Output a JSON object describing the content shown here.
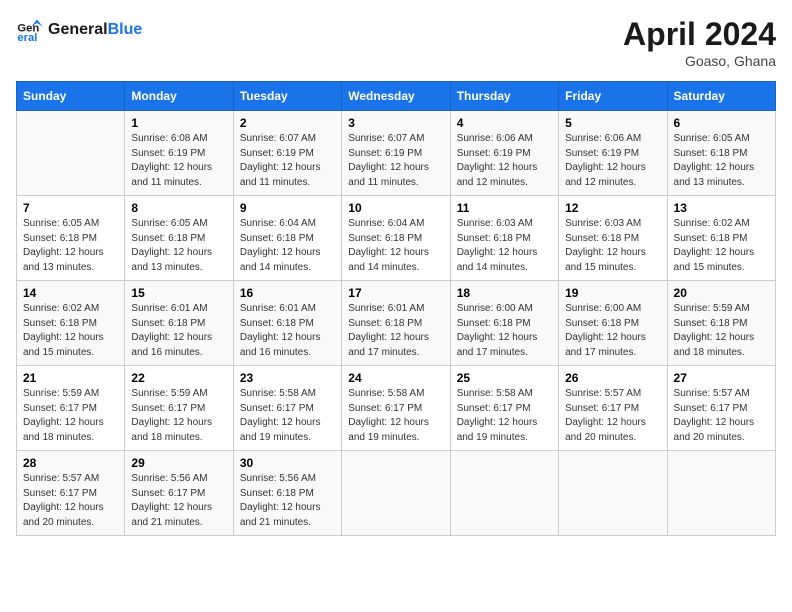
{
  "header": {
    "logo_line1": "General",
    "logo_line2": "Blue",
    "month": "April 2024",
    "location": "Goaso, Ghana"
  },
  "weekdays": [
    "Sunday",
    "Monday",
    "Tuesday",
    "Wednesday",
    "Thursday",
    "Friday",
    "Saturday"
  ],
  "weeks": [
    [
      {
        "day": "",
        "sunrise": "",
        "sunset": "",
        "daylight": ""
      },
      {
        "day": "1",
        "sunrise": "Sunrise: 6:08 AM",
        "sunset": "Sunset: 6:19 PM",
        "daylight": "Daylight: 12 hours and 11 minutes."
      },
      {
        "day": "2",
        "sunrise": "Sunrise: 6:07 AM",
        "sunset": "Sunset: 6:19 PM",
        "daylight": "Daylight: 12 hours and 11 minutes."
      },
      {
        "day": "3",
        "sunrise": "Sunrise: 6:07 AM",
        "sunset": "Sunset: 6:19 PM",
        "daylight": "Daylight: 12 hours and 11 minutes."
      },
      {
        "day": "4",
        "sunrise": "Sunrise: 6:06 AM",
        "sunset": "Sunset: 6:19 PM",
        "daylight": "Daylight: 12 hours and 12 minutes."
      },
      {
        "day": "5",
        "sunrise": "Sunrise: 6:06 AM",
        "sunset": "Sunset: 6:19 PM",
        "daylight": "Daylight: 12 hours and 12 minutes."
      },
      {
        "day": "6",
        "sunrise": "Sunrise: 6:05 AM",
        "sunset": "Sunset: 6:18 PM",
        "daylight": "Daylight: 12 hours and 13 minutes."
      }
    ],
    [
      {
        "day": "7",
        "sunrise": "Sunrise: 6:05 AM",
        "sunset": "Sunset: 6:18 PM",
        "daylight": "Daylight: 12 hours and 13 minutes."
      },
      {
        "day": "8",
        "sunrise": "Sunrise: 6:05 AM",
        "sunset": "Sunset: 6:18 PM",
        "daylight": "Daylight: 12 hours and 13 minutes."
      },
      {
        "day": "9",
        "sunrise": "Sunrise: 6:04 AM",
        "sunset": "Sunset: 6:18 PM",
        "daylight": "Daylight: 12 hours and 14 minutes."
      },
      {
        "day": "10",
        "sunrise": "Sunrise: 6:04 AM",
        "sunset": "Sunset: 6:18 PM",
        "daylight": "Daylight: 12 hours and 14 minutes."
      },
      {
        "day": "11",
        "sunrise": "Sunrise: 6:03 AM",
        "sunset": "Sunset: 6:18 PM",
        "daylight": "Daylight: 12 hours and 14 minutes."
      },
      {
        "day": "12",
        "sunrise": "Sunrise: 6:03 AM",
        "sunset": "Sunset: 6:18 PM",
        "daylight": "Daylight: 12 hours and 15 minutes."
      },
      {
        "day": "13",
        "sunrise": "Sunrise: 6:02 AM",
        "sunset": "Sunset: 6:18 PM",
        "daylight": "Daylight: 12 hours and 15 minutes."
      }
    ],
    [
      {
        "day": "14",
        "sunrise": "Sunrise: 6:02 AM",
        "sunset": "Sunset: 6:18 PM",
        "daylight": "Daylight: 12 hours and 15 minutes."
      },
      {
        "day": "15",
        "sunrise": "Sunrise: 6:01 AM",
        "sunset": "Sunset: 6:18 PM",
        "daylight": "Daylight: 12 hours and 16 minutes."
      },
      {
        "day": "16",
        "sunrise": "Sunrise: 6:01 AM",
        "sunset": "Sunset: 6:18 PM",
        "daylight": "Daylight: 12 hours and 16 minutes."
      },
      {
        "day": "17",
        "sunrise": "Sunrise: 6:01 AM",
        "sunset": "Sunset: 6:18 PM",
        "daylight": "Daylight: 12 hours and 17 minutes."
      },
      {
        "day": "18",
        "sunrise": "Sunrise: 6:00 AM",
        "sunset": "Sunset: 6:18 PM",
        "daylight": "Daylight: 12 hours and 17 minutes."
      },
      {
        "day": "19",
        "sunrise": "Sunrise: 6:00 AM",
        "sunset": "Sunset: 6:18 PM",
        "daylight": "Daylight: 12 hours and 17 minutes."
      },
      {
        "day": "20",
        "sunrise": "Sunrise: 5:59 AM",
        "sunset": "Sunset: 6:18 PM",
        "daylight": "Daylight: 12 hours and 18 minutes."
      }
    ],
    [
      {
        "day": "21",
        "sunrise": "Sunrise: 5:59 AM",
        "sunset": "Sunset: 6:17 PM",
        "daylight": "Daylight: 12 hours and 18 minutes."
      },
      {
        "day": "22",
        "sunrise": "Sunrise: 5:59 AM",
        "sunset": "Sunset: 6:17 PM",
        "daylight": "Daylight: 12 hours and 18 minutes."
      },
      {
        "day": "23",
        "sunrise": "Sunrise: 5:58 AM",
        "sunset": "Sunset: 6:17 PM",
        "daylight": "Daylight: 12 hours and 19 minutes."
      },
      {
        "day": "24",
        "sunrise": "Sunrise: 5:58 AM",
        "sunset": "Sunset: 6:17 PM",
        "daylight": "Daylight: 12 hours and 19 minutes."
      },
      {
        "day": "25",
        "sunrise": "Sunrise: 5:58 AM",
        "sunset": "Sunset: 6:17 PM",
        "daylight": "Daylight: 12 hours and 19 minutes."
      },
      {
        "day": "26",
        "sunrise": "Sunrise: 5:57 AM",
        "sunset": "Sunset: 6:17 PM",
        "daylight": "Daylight: 12 hours and 20 minutes."
      },
      {
        "day": "27",
        "sunrise": "Sunrise: 5:57 AM",
        "sunset": "Sunset: 6:17 PM",
        "daylight": "Daylight: 12 hours and 20 minutes."
      }
    ],
    [
      {
        "day": "28",
        "sunrise": "Sunrise: 5:57 AM",
        "sunset": "Sunset: 6:17 PM",
        "daylight": "Daylight: 12 hours and 20 minutes."
      },
      {
        "day": "29",
        "sunrise": "Sunrise: 5:56 AM",
        "sunset": "Sunset: 6:17 PM",
        "daylight": "Daylight: 12 hours and 21 minutes."
      },
      {
        "day": "30",
        "sunrise": "Sunrise: 5:56 AM",
        "sunset": "Sunset: 6:18 PM",
        "daylight": "Daylight: 12 hours and 21 minutes."
      },
      {
        "day": "",
        "sunrise": "",
        "sunset": "",
        "daylight": ""
      },
      {
        "day": "",
        "sunrise": "",
        "sunset": "",
        "daylight": ""
      },
      {
        "day": "",
        "sunrise": "",
        "sunset": "",
        "daylight": ""
      },
      {
        "day": "",
        "sunrise": "",
        "sunset": "",
        "daylight": ""
      }
    ]
  ]
}
